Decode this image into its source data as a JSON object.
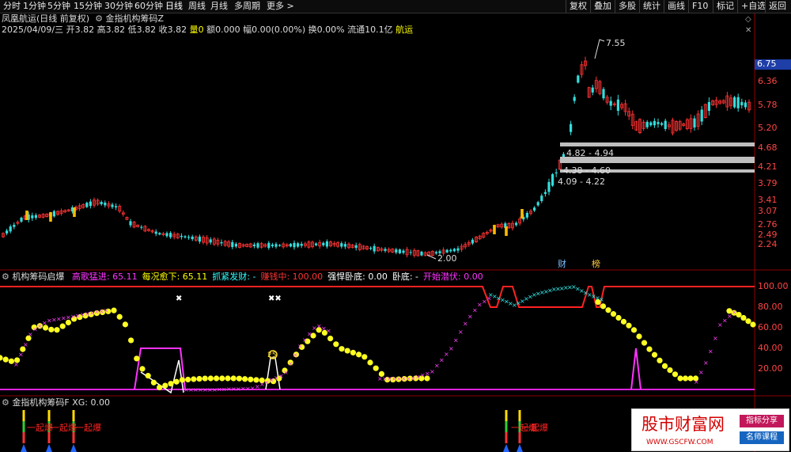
{
  "toolbar": {
    "timeframes": [
      "分时",
      "1分钟",
      "5分钟",
      "15分钟",
      "30分钟",
      "60分钟",
      "日线",
      "周线",
      "月线",
      "多周期",
      "更多"
    ],
    "active": "日线",
    "right_buttons": [
      "复权",
      "叠加",
      "多股",
      "统计",
      "画线",
      "F10",
      "标记",
      "+自选",
      "返回"
    ]
  },
  "main_panel": {
    "title": "凤凰航运(日线 前复权)",
    "indicator": "金指机构筹码Z",
    "info": {
      "date": "2025/04/09/三",
      "open": "开3.82",
      "high": "高3.82",
      "low": "低3.82",
      "close": "收3.82",
      "vol": "量0",
      "amt": "额0.000",
      "chg": "幅0.00(0.00%)",
      "turn": "换0.00%",
      "float": "流通10.1亿",
      "sector": "航运"
    },
    "price_axis": [
      "6.75",
      "6.36",
      "5.78",
      "5.20",
      "4.68",
      "4.21",
      "3.79",
      "3.41",
      "3.07",
      "2.76",
      "2.49",
      "2.24"
    ],
    "last_price": "6.75",
    "annotations": {
      "high": "7.55",
      "low": "2.00",
      "zone1": "4.82 - 4.94",
      "zone2": "4.38 - 4.60",
      "zone3": "4.09 - 4.22"
    },
    "badges": [
      "财",
      "榜"
    ]
  },
  "panel2": {
    "name": "机构筹码启爆",
    "fields": [
      {
        "label": "高歌猛进:",
        "value": "65.11",
        "color": "#ff33ff"
      },
      {
        "label": "每况愈下:",
        "value": "65.11",
        "color": "#ffff00"
      },
      {
        "label": "抓紧发财:",
        "value": "-",
        "color": "#33ffff"
      },
      {
        "label": "赚钱中:",
        "value": "100.00",
        "color": "#ff3333"
      },
      {
        "label": "强悍卧底:",
        "value": "0.00",
        "color": "#ffffff"
      },
      {
        "label": "卧底:",
        "value": "-",
        "color": "#ffffff"
      },
      {
        "label": "开始潜伏:",
        "value": "0.00",
        "color": "#ff33ff"
      }
    ],
    "axis": [
      "100.00",
      "80.00",
      "60.00",
      "40.00",
      "20.00"
    ],
    "marker_text": "25"
  },
  "panel3": {
    "name": "金指机构筹码F",
    "field": "XG:",
    "value": "0.00",
    "signal_label": "一起爆"
  },
  "watermark": {
    "title": "股市财富网",
    "url": "WWW.GSCFW.COM",
    "tag1": "指标分享",
    "tag2": "名师课程"
  },
  "chart_data": {
    "type": "candlestick",
    "y_axis_ticks": [
      2.24,
      2.49,
      2.76,
      3.07,
      3.41,
      3.79,
      4.21,
      4.68,
      5.2,
      5.78,
      6.36,
      6.75
    ],
    "high_label": 7.55,
    "low_label": 2.0
  }
}
